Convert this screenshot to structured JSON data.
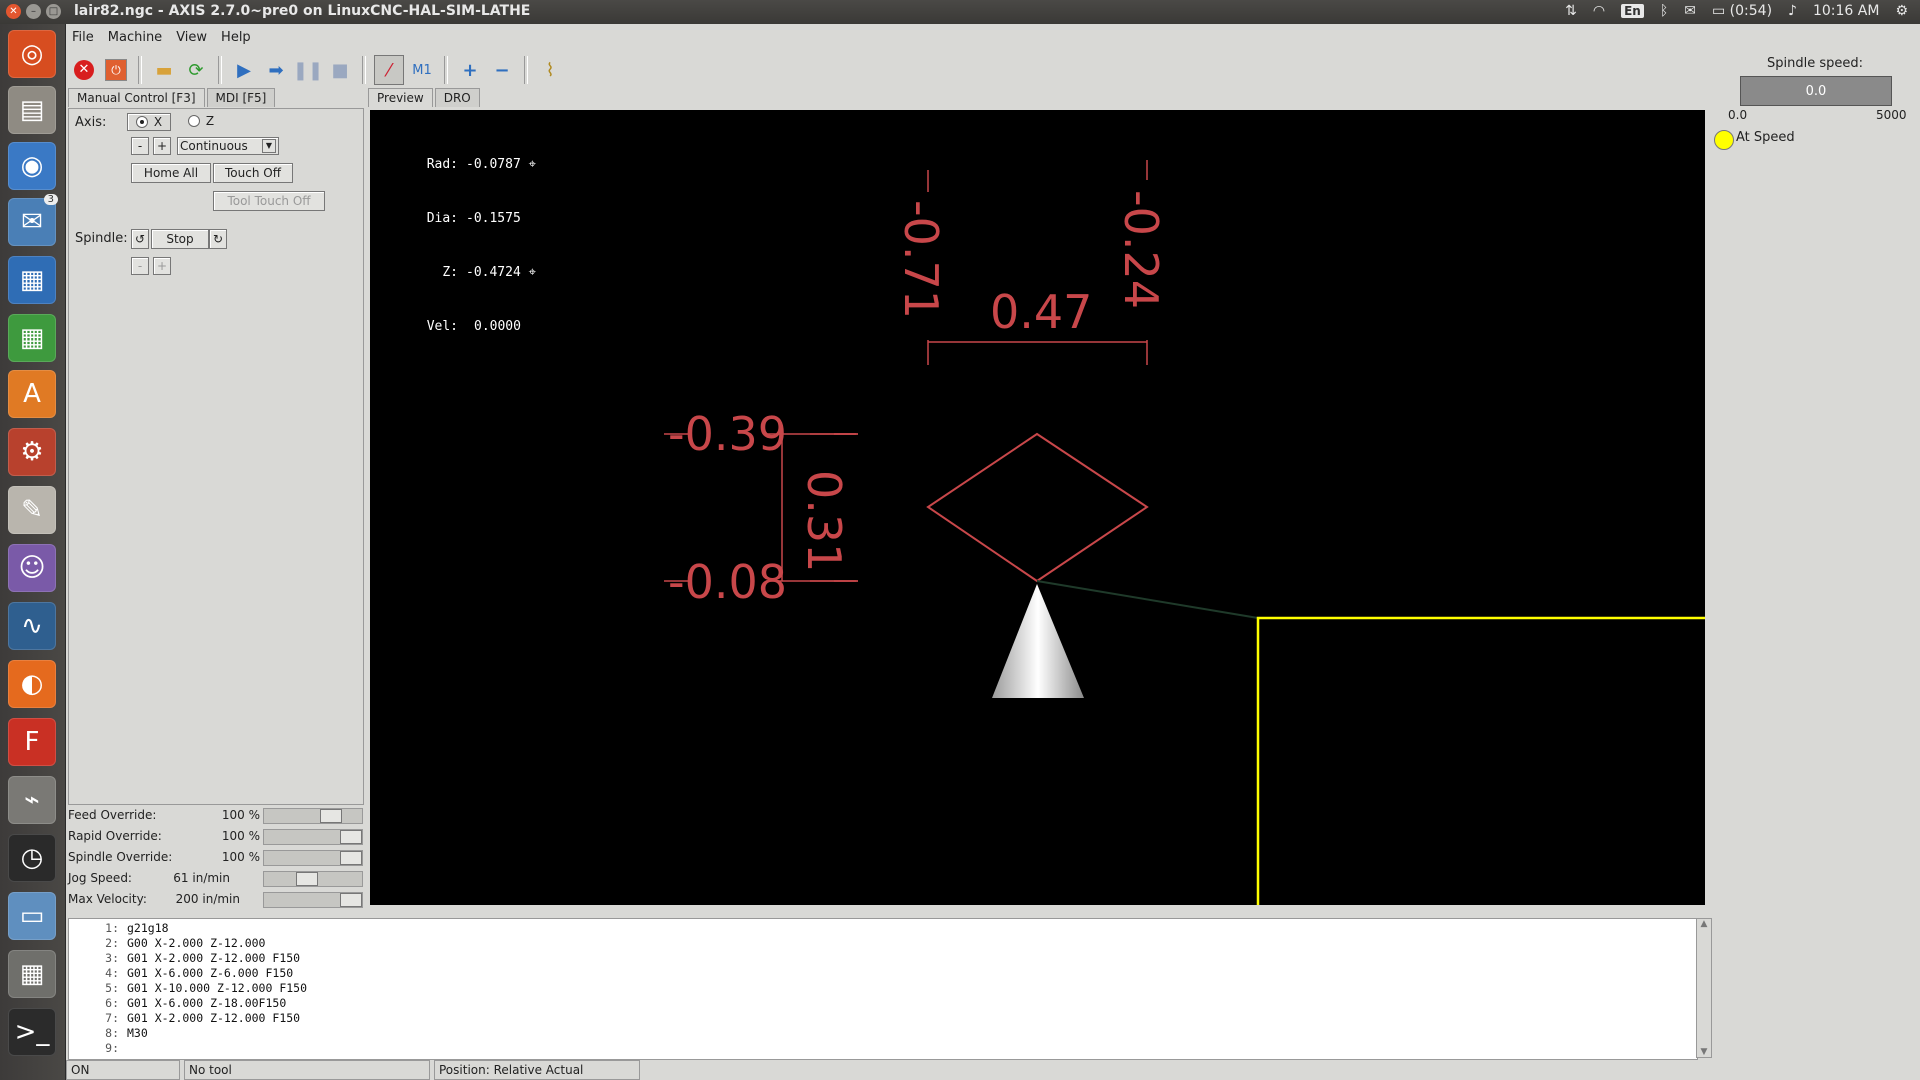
{
  "window": {
    "title": "lair82.ngc - AXIS 2.7.0~pre0 on LinuxCNC-HAL-SIM-LATHE"
  },
  "tray": {
    "language": "En",
    "battery": "(0:54)",
    "clock": "10:16 AM"
  },
  "menu": [
    "File",
    "Machine",
    "View",
    "Help"
  ],
  "left_tabs": {
    "manual": "Manual Control [F3]",
    "mdi": "MDI [F5]"
  },
  "manual": {
    "axis_label": "Axis:",
    "axis_x": "X",
    "axis_z": "Z",
    "minus": "-",
    "plus": "+",
    "jog_mode": "Continuous",
    "home_all": "Home All",
    "touch_off": "Touch Off",
    "tool_touch_off": "Tool Touch Off",
    "spindle_label": "Spindle:",
    "spindle_stop": "Stop"
  },
  "overrides": {
    "feed": {
      "label": "Feed Override:",
      "value": "100 %"
    },
    "rapid": {
      "label": "Rapid Override:",
      "value": "100 %"
    },
    "spindle": {
      "label": "Spindle Override:",
      "value": "100 %"
    },
    "jog": {
      "label": "Jog Speed:",
      "value": "61 in/min"
    },
    "maxvel": {
      "label": "Max Velocity:",
      "value": "200 in/min"
    }
  },
  "preview_tabs": {
    "preview": "Preview",
    "dro": "DRO"
  },
  "dro": [
    {
      "key": "Rad:",
      "value": "-0.0787"
    },
    {
      "key": "Dia:",
      "value": "-0.1575"
    },
    {
      "key": "Z:",
      "value": "-0.4724"
    },
    {
      "key": "Vel:",
      "value": "0.0000"
    }
  ],
  "dimensions": {
    "top_left": "-0.71",
    "top_right": "-0.24",
    "width": "0.47",
    "left_top": "-0.39",
    "left_bottom": "-0.08",
    "height": "0.31"
  },
  "spindle_panel": {
    "title": "Spindle speed:",
    "value": "0.0",
    "min": "0.0",
    "max": "5000",
    "at_speed": "At Speed"
  },
  "gcode": [
    {
      "n": "1:",
      "code": "g21g18"
    },
    {
      "n": "2:",
      "code": "G00 X-2.000 Z-12.000"
    },
    {
      "n": "3:",
      "code": "G01 X-2.000 Z-12.000 F150"
    },
    {
      "n": "4:",
      "code": "G01 X-6.000 Z-6.000 F150"
    },
    {
      "n": "5:",
      "code": "G01 X-10.000 Z-12.000 F150"
    },
    {
      "n": "6:",
      "code": "G01 X-6.000 Z-18.00F150"
    },
    {
      "n": "7:",
      "code": "G01 X-2.000 Z-12.000 F150"
    },
    {
      "n": "8:",
      "code": "M30"
    },
    {
      "n": "9:",
      "code": ""
    }
  ],
  "status": {
    "state": "ON",
    "tool": "No tool",
    "position": "Position: Relative Actual"
  },
  "colors": {
    "dimension": "#c8474a",
    "stock": "#ffff00",
    "preview_bg": "#000000"
  }
}
